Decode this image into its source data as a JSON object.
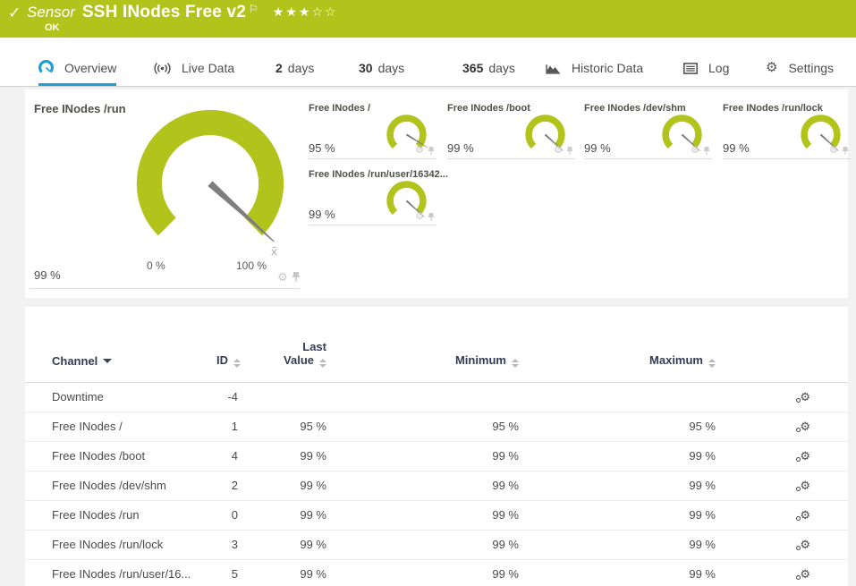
{
  "icons": {
    "check": "✓",
    "flag": "⚐",
    "gear": "⚙"
  },
  "header": {
    "kind_label": "Sensor",
    "title": "SSH INodes Free v2",
    "rating_filled": "★★★",
    "rating_empty": "☆☆",
    "status": "OK"
  },
  "tabs": [
    {
      "bold": "",
      "text": "Overview",
      "active": true
    },
    {
      "bold": "",
      "text": "Live Data"
    },
    {
      "bold": "2",
      "text": "days"
    },
    {
      "bold": "30",
      "text": "days"
    },
    {
      "bold": "365",
      "text": "days"
    },
    {
      "bold": "",
      "text": "Historic Data"
    },
    {
      "bold": "",
      "text": "Log"
    },
    {
      "bold": "",
      "text": "Settings"
    }
  ],
  "gauges": {
    "primary": {
      "title": "Free INodes /run",
      "value": "99 %",
      "value_num": 99,
      "min_label": "0 %",
      "max_label": "100 %",
      "avg_marker": "x̄"
    },
    "small": [
      {
        "title": "Free INodes /",
        "value": "95 %",
        "value_num": 95
      },
      {
        "title": "Free INodes /boot",
        "value": "99 %",
        "value_num": 99
      },
      {
        "title": "Free INodes /dev/shm",
        "value": "99 %",
        "value_num": 99
      },
      {
        "title": "Free INodes /run/lock",
        "value": "99 %",
        "value_num": 99
      },
      {
        "title": "Free INodes /run/user/16342...",
        "value": "99 %",
        "value_num": 99
      }
    ]
  },
  "table": {
    "columns": {
      "channel": "Channel",
      "id": "ID",
      "last1": "Last",
      "last2": "Value",
      "min": "Minimum",
      "max": "Maximum"
    },
    "rows": [
      {
        "channel": "Downtime",
        "id": "-4",
        "last": "",
        "min": "",
        "max": ""
      },
      {
        "channel": "Free INodes /",
        "id": "1",
        "last": "95 %",
        "min": "95 %",
        "max": "95 %"
      },
      {
        "channel": "Free INodes /boot",
        "id": "4",
        "last": "99 %",
        "min": "99 %",
        "max": "99 %"
      },
      {
        "channel": "Free INodes /dev/shm",
        "id": "2",
        "last": "99 %",
        "min": "99 %",
        "max": "99 %"
      },
      {
        "channel": "Free INodes /run",
        "id": "0",
        "last": "99 %",
        "min": "99 %",
        "max": "99 %"
      },
      {
        "channel": "Free INodes /run/lock",
        "id": "3",
        "last": "99 %",
        "min": "99 %",
        "max": "99 %"
      },
      {
        "channel": "Free INodes /run/user/16...",
        "id": "5",
        "last": "99 %",
        "min": "99 %",
        "max": "99 %"
      }
    ]
  },
  "colors": {
    "brand_green": "#b2c41c",
    "accent_blue": "#1ca0d7",
    "header_navy": "#333c55"
  }
}
